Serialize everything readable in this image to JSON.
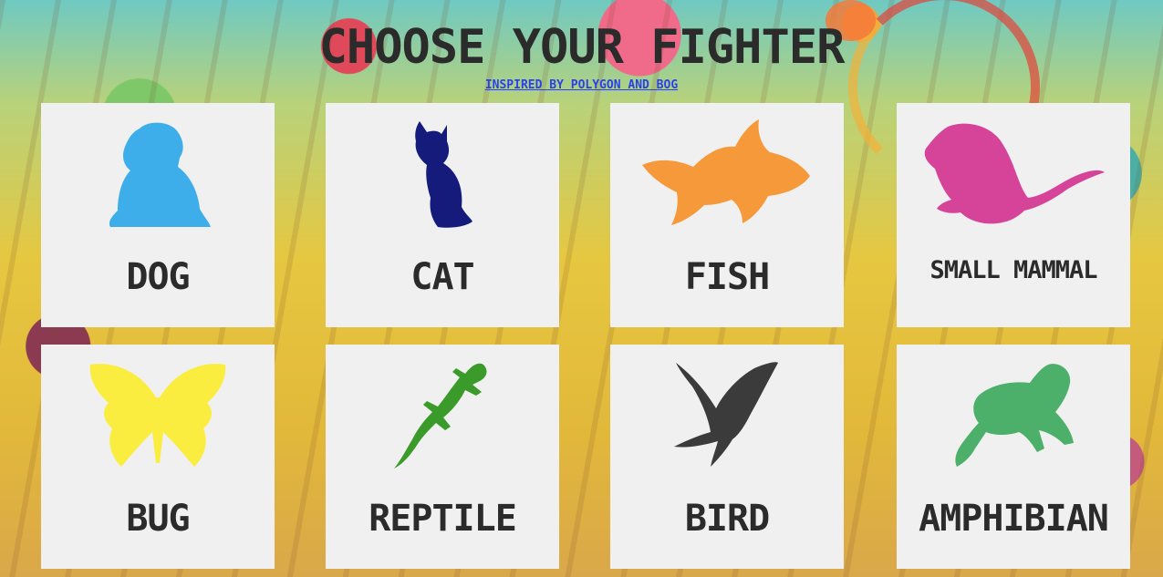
{
  "header": {
    "title": "CHOOSE YOUR FIGHTER",
    "subtitle": "INSPIRED BY POLYGON AND BOG"
  },
  "cards": [
    {
      "label": "DOG",
      "icon": "dog-icon",
      "color": "#3daee9"
    },
    {
      "label": "CAT",
      "icon": "cat-icon",
      "color": "#141b7a"
    },
    {
      "label": "FISH",
      "icon": "fish-icon",
      "color": "#f5993a"
    },
    {
      "label": "SMALL MAMMAL",
      "icon": "small-mammal-icon",
      "color": "#d6449a"
    },
    {
      "label": "BUG",
      "icon": "butterfly-icon",
      "color": "#fbed3f"
    },
    {
      "label": "REPTILE",
      "icon": "lizard-icon",
      "color": "#3a9a2a"
    },
    {
      "label": "BIRD",
      "icon": "bird-icon",
      "color": "#3b3b3b"
    },
    {
      "label": "AMPHIBIAN",
      "icon": "frog-icon",
      "color": "#4caf6a"
    }
  ]
}
